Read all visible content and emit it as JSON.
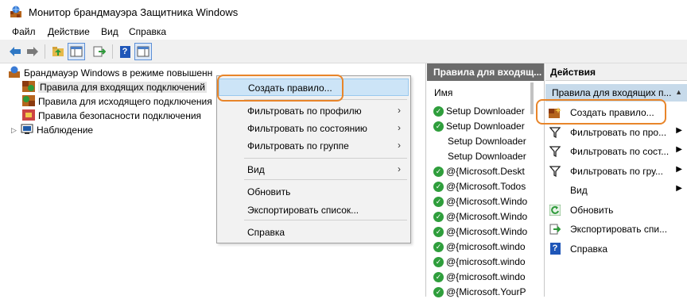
{
  "window": {
    "title": "Монитор брандмауэра Защитника Windows"
  },
  "menubar": {
    "items": [
      "Файл",
      "Действие",
      "Вид",
      "Справка"
    ]
  },
  "toolbar": {
    "buttons": [
      "back-icon",
      "forward-icon",
      "up-folder-icon",
      "show-hide-tree-icon",
      "export-icon",
      "help-icon",
      "action-pane-icon"
    ]
  },
  "tree": {
    "root": "Брандмауэр Windows в режиме повышенн",
    "items": [
      "Правила для входящих подключений",
      "Правила для исходящего подключения",
      "Правила безопасности подключения",
      "Наблюдение"
    ]
  },
  "context_menu": {
    "items": [
      {
        "label": "Создать правило...",
        "highlighted": true
      },
      {
        "label": "Фильтровать по профилю",
        "submenu": true
      },
      {
        "label": "Фильтровать по состоянию",
        "submenu": true
      },
      {
        "label": "Фильтровать по группе",
        "submenu": true
      },
      {
        "label": "Вид",
        "submenu": true
      },
      {
        "label": "Обновить"
      },
      {
        "label": "Экспортировать список..."
      },
      {
        "label": "Справка"
      }
    ]
  },
  "list": {
    "header": "Правила для входящ...",
    "column": "Имя",
    "rows": [
      {
        "name": "Setup Downloader",
        "enabled": true
      },
      {
        "name": "Setup Downloader",
        "enabled": true
      },
      {
        "name": "Setup Downloader",
        "enabled": false
      },
      {
        "name": "Setup Downloader",
        "enabled": false
      },
      {
        "name": "@{Microsoft.Deskt",
        "enabled": true
      },
      {
        "name": "@{Microsoft.Todos",
        "enabled": true
      },
      {
        "name": "@{Microsoft.Windo",
        "enabled": true
      },
      {
        "name": "@{Microsoft.Windo",
        "enabled": true
      },
      {
        "name": "@{Microsoft.Windo",
        "enabled": true
      },
      {
        "name": "@{microsoft.windo",
        "enabled": true
      },
      {
        "name": "@{microsoft.windo",
        "enabled": true
      },
      {
        "name": "@{microsoft.windo",
        "enabled": true
      },
      {
        "name": "@{Microsoft.YourP",
        "enabled": true
      }
    ]
  },
  "actions": {
    "header": "Действия",
    "section": "Правила для входящих п...",
    "items": [
      {
        "label": "Создать правило...",
        "icon": "new-rule-icon"
      },
      {
        "label": "Фильтровать по про...",
        "icon": "filter-icon",
        "submenu": true
      },
      {
        "label": "Фильтровать по сост...",
        "icon": "filter-icon",
        "submenu": true
      },
      {
        "label": "Фильтровать по гру...",
        "icon": "filter-icon",
        "submenu": true
      },
      {
        "label": "Вид",
        "icon": "",
        "submenu": true
      },
      {
        "label": "Обновить",
        "icon": "refresh-icon"
      },
      {
        "label": "Экспортировать спи...",
        "icon": "export-icon"
      },
      {
        "label": "Справка",
        "icon": "help-icon"
      }
    ]
  },
  "colors": {
    "highlight_orange": "#e8852a",
    "menu_highlight": "#cce4f7",
    "list_header": "#6b6b6b",
    "actions_section": "#c7daea",
    "check_green": "#2f9e3c"
  }
}
